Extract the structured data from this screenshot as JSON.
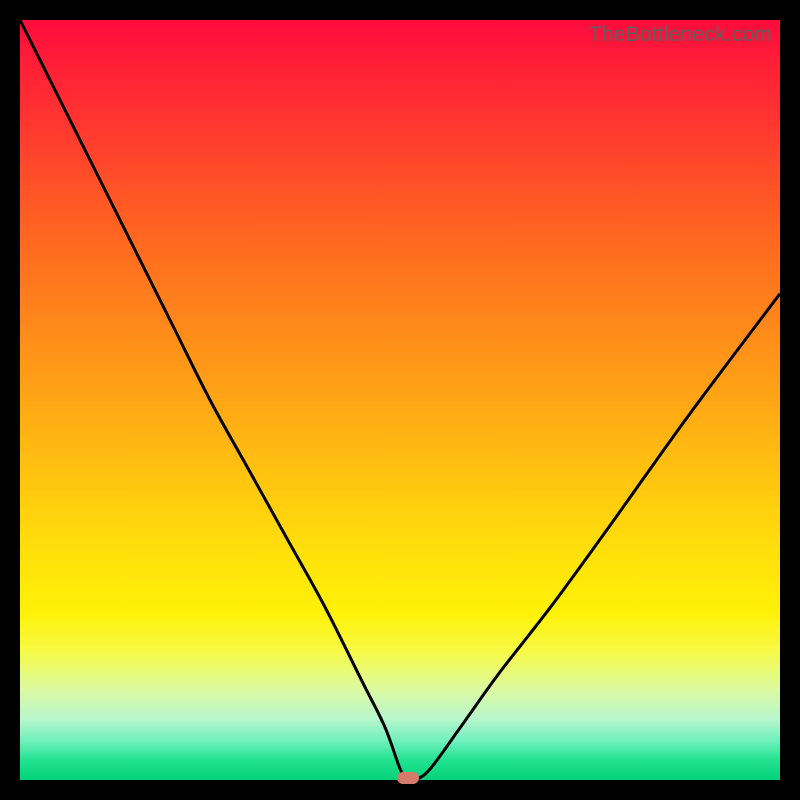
{
  "watermark": "TheBottleneck.com",
  "colors": {
    "curve_stroke": "#000000",
    "marker_fill": "#d37a6b",
    "frame_bg": "#000000"
  },
  "chart_data": {
    "type": "line",
    "title": "",
    "xlabel": "",
    "ylabel": "",
    "xlim": [
      0,
      100
    ],
    "ylim": [
      0,
      100
    ],
    "grid": false,
    "legend": false,
    "marker": {
      "x": 51,
      "y": 0,
      "shape": "rounded-rect"
    },
    "series": [
      {
        "name": "bottleneck-curve",
        "x": [
          0,
          5,
          10,
          15,
          20,
          25,
          30,
          35,
          40,
          45,
          48,
          50,
          51,
          52,
          54,
          58,
          63,
          70,
          78,
          88,
          100
        ],
        "y": [
          100,
          90,
          80,
          70,
          60,
          50,
          41,
          32,
          23,
          13,
          7,
          1.5,
          0,
          0,
          1.5,
          7,
          14,
          23,
          34,
          48,
          64
        ]
      }
    ]
  }
}
